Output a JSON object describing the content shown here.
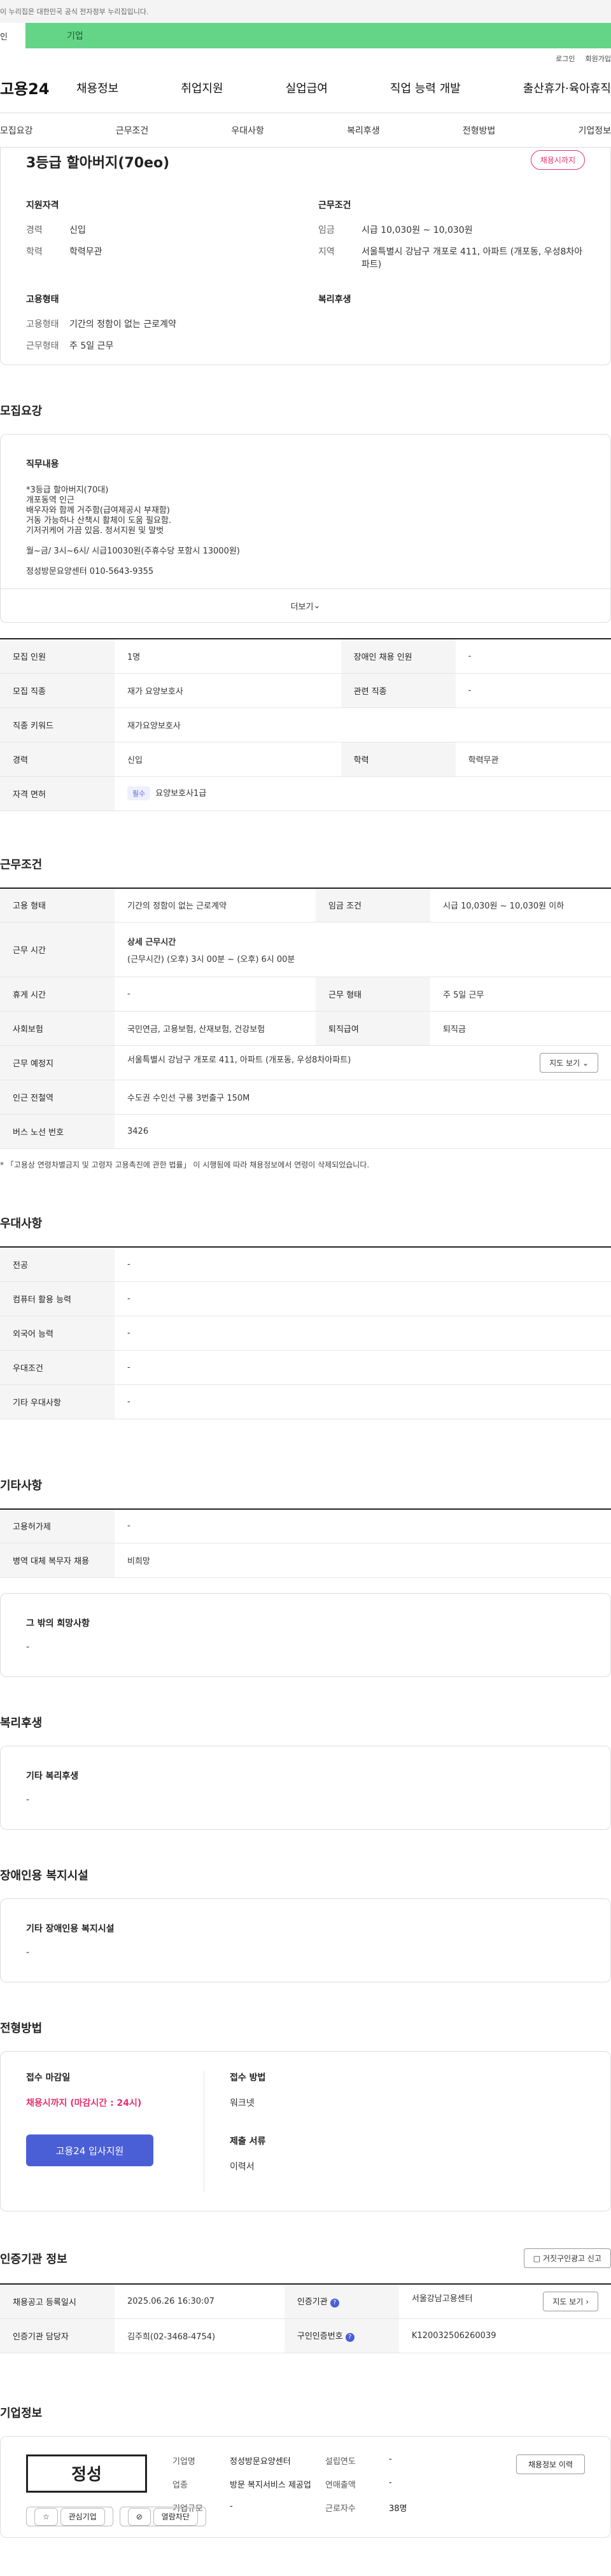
{
  "top_notice": "이 누리집은 대한민국 공식 전자정부 누리집입니다.",
  "user_tabs": {
    "individual": "인",
    "company": "기업"
  },
  "utility": {
    "login": "로그인",
    "join": "회원가입"
  },
  "logo": "고용24",
  "gnb": [
    "채용정보",
    "취업지원",
    "실업급여",
    "직업 능력 개발",
    "출산휴가·육아휴직"
  ],
  "anchors": [
    "모집요강",
    "근무조건",
    "우대사항",
    "복리후생",
    "전형방법",
    "기업정보"
  ],
  "summary": {
    "title": "3등급 할아버지(70eo)",
    "status": "채용시까지",
    "qual_title": "지원자격",
    "qual": [
      {
        "k": "경력",
        "v": "신입"
      },
      {
        "k": "학력",
        "v": "학력무관"
      }
    ],
    "cond_title": "근무조건",
    "cond": [
      {
        "k": "임금",
        "v": "시급 10,030원 ~ 10,030원"
      },
      {
        "k": "지역",
        "v": "서울특별시 강남구 개포로 411, 아파트 (개포동, 우성8차아파트)"
      }
    ],
    "emp_title": "고용형태",
    "emp": [
      {
        "k": "고용형태",
        "v": "기간의 정함이 없는 근로계약"
      },
      {
        "k": "근무형태",
        "v": "주 5일 근무"
      }
    ],
    "welfare_title": "복리후생"
  },
  "recruit": {
    "title": "모집요강",
    "duty_title": "직무내용",
    "duty_lines": [
      "*3등급 할아버지(70대)",
      "개포동역 인근",
      "배우자와 함께 거주함(급여제공시 부재함)",
      "거동 가능하나 산책시 활체이 도움 필요함.",
      "기저귀케어 가끔 있음. 정서지원 및 말벗",
      "",
      "월~금/ 3시~6시/ 시급10030원(주휴수당 포함시 13000원)",
      "",
      "정성방문요양센터 010-5643-9355"
    ],
    "more": "더보기",
    "rows": {
      "headcount_k": "모집 인원",
      "headcount_v": "1명",
      "disabled_k": "장애인 채용 인원",
      "disabled_v": "-",
      "job_k": "모집 직종",
      "job_v": "재가 요양보호사",
      "related_k": "관련 직종",
      "related_v": "-",
      "keyword_k": "직종 키워드",
      "keyword_v": "재가요양보호사",
      "career_k": "경력",
      "career_v": "신입",
      "edu_k": "학력",
      "edu_v": "학력무관",
      "license_k": "자격 면허",
      "license_tag": "필수",
      "license_v": "요양보호사1급"
    }
  },
  "work": {
    "title": "근무조건",
    "type_k": "고용 형태",
    "type_v": "기간의 정함이 없는 근로계약",
    "wage_k": "임금 조건",
    "wage_v": "시급 10,030원 ~ 10,030원 이하",
    "hours_k": "근무 시간",
    "hours_sub": "상세 근무시간",
    "hours_v": "(근무시간) (오후) 3시 00분 ~ (오후) 6시 00분",
    "holiday_k": "휴게 시간",
    "holiday_v": "-",
    "form_k": "근무 형태",
    "form_v": "주 5일 근무",
    "insurance_k": "사회보험",
    "insurance_v": "국민연금, 고용보험, 산재보험, 건강보험",
    "retire_k": "퇴직급여",
    "retire_v": "퇴직금",
    "place_k": "근무 예정지",
    "place_v": "서울특별시 강남구 개포로 411, 아파트 (개포동, 우성8차아파트)",
    "map_btn": "지도 보기",
    "station_k": "인근 전철역",
    "station_v": "수도권 수인선 구룡 3번출구 150M",
    "bus_k": "버스 노선 번호",
    "bus_v": "3426",
    "note": "* 「고용상 연령차별금지 및 고령자 고용촉진에 관한 법률」 이 시행됨에 따라 채용정보에서 연령이 삭제되었습니다."
  },
  "prefer": {
    "title": "우대사항",
    "rows": [
      {
        "k": "전공",
        "v": "-"
      },
      {
        "k": "컴퓨터 활용 능력",
        "v": "-"
      },
      {
        "k": "외국어 능력",
        "v": "-"
      },
      {
        "k": "우대조건",
        "v": "-"
      },
      {
        "k": "기타 우대사항",
        "v": "-"
      }
    ]
  },
  "etc": {
    "title": "기타사항",
    "rows": [
      {
        "k": "고용허가제",
        "v": "-"
      },
      {
        "k": "병역 대체 복무자 채용",
        "v": "비희망"
      }
    ],
    "wish_title": "그 밖의 희망사항",
    "wish_v": "-"
  },
  "welfare": {
    "title": "복리후생",
    "box_title": "기타 복리후생",
    "box_v": "-"
  },
  "disabled": {
    "title": "장애인용 복지시설",
    "box_title": "기타 장애인용 복지시설",
    "box_v": "-"
  },
  "screening": {
    "title": "전형방법",
    "deadline_title": "접수 마감일",
    "deadline_v": "채용시까지 (마감시간 : 24시)",
    "apply_btn": "고용24 입사지원",
    "method_title": "접수 방법",
    "method_v": "워크넷",
    "docs_title": "제출 서류",
    "docs_v": "이력서"
  },
  "agency": {
    "title": "인증기관 정보",
    "report_btn": "거짓구인광고 신고",
    "reg_k": "채용공고 등록일시",
    "reg_v": "2025.06.26 16:30:07",
    "org_k": "인증기관",
    "org_v": "서울강남고용센터",
    "map_btn": "지도 보기",
    "manager_k": "인증기관 담당자",
    "manager_v": "김주희(02-3468-4754)",
    "cert_k": "구인인증번호",
    "cert_v": "K120032506260039"
  },
  "company": {
    "title": "기업정보",
    "logo_text": "정성",
    "interest_btn": "관심기업",
    "block_btn": "열람차단",
    "history_btn": "채용정보 이력",
    "name_k": "기업명",
    "name_v": "정성방문요양센터",
    "found_k": "설립연도",
    "found_v": "-",
    "industry_k": "업종",
    "industry_v": "방문 복지서비스 제공업",
    "sales_k": "연매출액",
    "sales_v": "-",
    "staff_k": "근로자수",
    "staff_v": "38명",
    "scale_k": "기업규모",
    "scale_v": "-"
  }
}
